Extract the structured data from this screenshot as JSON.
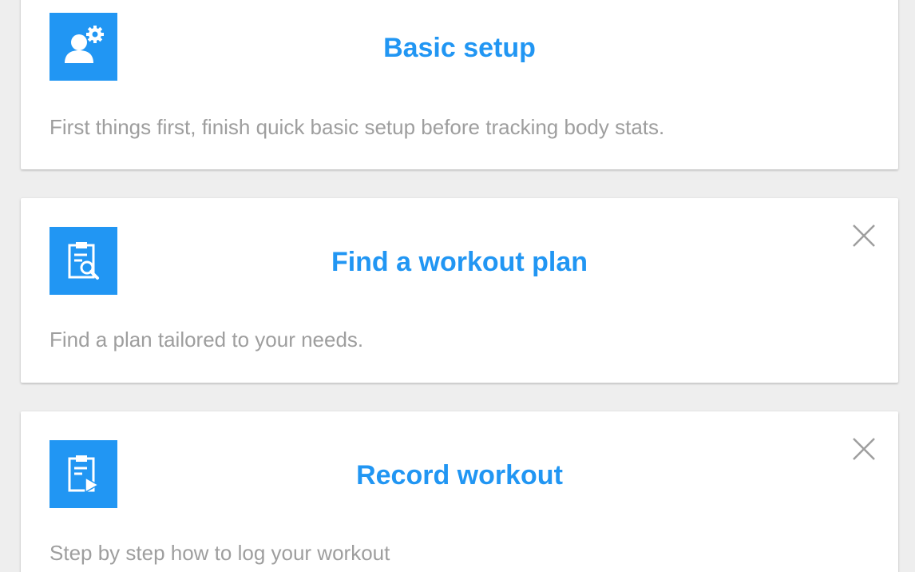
{
  "theme": {
    "accent": "#2196f3",
    "background": "#eeeeee",
    "card": "#ffffff",
    "description_text": "#9e9e9e",
    "dismiss_icon": "#9e9e9e"
  },
  "cards": [
    {
      "icon": "user-settings-icon",
      "title": "Basic setup",
      "description": "First things first, finish quick basic setup before tracking body stats.",
      "dismissible": false
    },
    {
      "icon": "clipboard-search-icon",
      "title": "Find a workout plan",
      "description": "Find a plan tailored to your needs.",
      "dismissible": true
    },
    {
      "icon": "clipboard-play-icon",
      "title": "Record workout",
      "description": "Step by step how to log your workout",
      "dismissible": true
    }
  ]
}
